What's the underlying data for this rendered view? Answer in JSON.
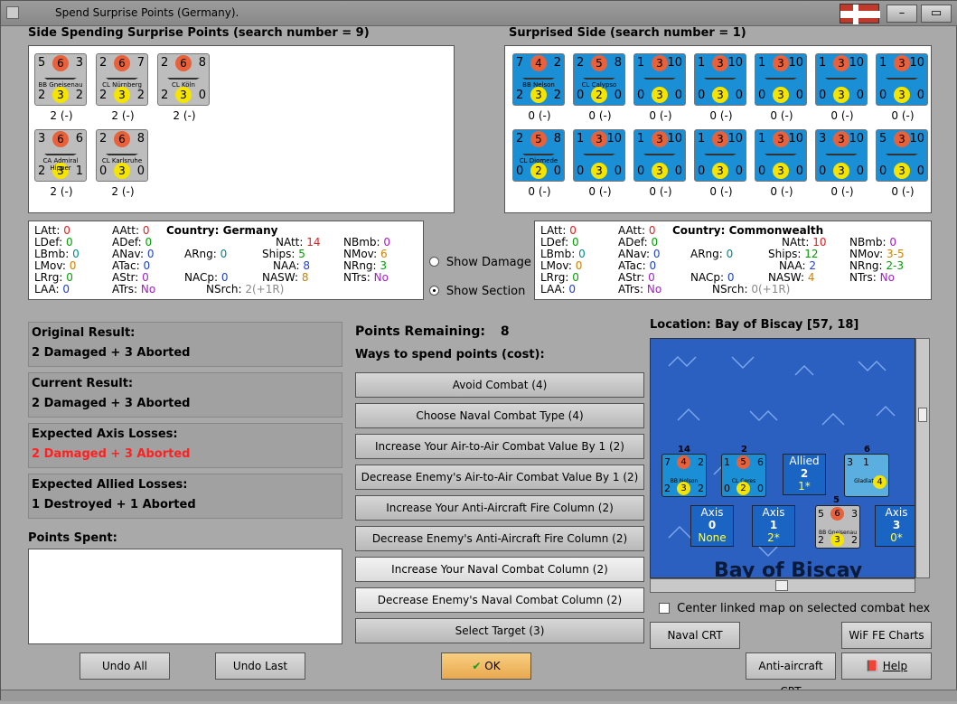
{
  "window": {
    "title": "Spend Surprise Points (Germany)."
  },
  "left_panel": {
    "header": "Side Spending Surprise Points (search number = 9)",
    "units": [
      {
        "name": "BB Gneisenau",
        "tl": "5",
        "tm": "6",
        "tr": "3",
        "bl": "2",
        "bm": "3",
        "br": "2",
        "label": "2 (-)"
      },
      {
        "name": "CL Nürnberg",
        "tl": "2",
        "tm": "6",
        "tr": "7",
        "bl": "2",
        "bm": "3",
        "br": "2",
        "label": "2 (-)"
      },
      {
        "name": "CL Köln",
        "tl": "2",
        "tm": "6",
        "tr": "8",
        "bl": "2",
        "bm": "3",
        "br": "0",
        "label": "2 (-)"
      },
      {
        "name": "CA Admiral Hipper",
        "tl": "3",
        "tm": "6",
        "tr": "6",
        "bl": "2",
        "bm": "3",
        "br": "1",
        "label": "2 (-)"
      },
      {
        "name": "CL Karlsruhe",
        "tl": "2",
        "tm": "6",
        "tr": "8",
        "bl": "0",
        "bm": "3",
        "br": "0",
        "label": "2 (-)"
      }
    ]
  },
  "right_panel": {
    "header": "Surprised Side (search number = 1)",
    "units": [
      {
        "name": "BB Nelson",
        "tl": "7",
        "tm": "4",
        "tr": "2",
        "bl": "2",
        "bm": "3",
        "br": "2",
        "label": "0 (-)"
      },
      {
        "name": "CL Calypso",
        "tl": "2",
        "tm": "5",
        "tr": "8",
        "bl": "0",
        "bm": "2",
        "br": "0",
        "label": "0 (-)"
      },
      {
        "name": "",
        "tl": "1",
        "tm": "3",
        "tr": "10",
        "bl": "0",
        "bm": "3",
        "br": "0",
        "label": "0 (-)"
      },
      {
        "name": "",
        "tl": "1",
        "tm": "3",
        "tr": "10",
        "bl": "0",
        "bm": "3",
        "br": "0",
        "label": "0 (-)"
      },
      {
        "name": "",
        "tl": "1",
        "tm": "3",
        "tr": "10",
        "bl": "0",
        "bm": "3",
        "br": "0",
        "label": "0 (-)"
      },
      {
        "name": "",
        "tl": "1",
        "tm": "3",
        "tr": "10",
        "bl": "0",
        "bm": "3",
        "br": "0",
        "label": "0 (-)"
      },
      {
        "name": "",
        "tl": "1",
        "tm": "3",
        "tr": "10",
        "bl": "0",
        "bm": "3",
        "br": "0",
        "label": "0 (-)"
      },
      {
        "name": "CL Diomede",
        "tl": "2",
        "tm": "5",
        "tr": "8",
        "bl": "0",
        "bm": "2",
        "br": "0",
        "label": "0 (-)"
      },
      {
        "name": "",
        "tl": "1",
        "tm": "3",
        "tr": "10",
        "bl": "0",
        "bm": "3",
        "br": "0",
        "label": "0 (-)"
      },
      {
        "name": "",
        "tl": "1",
        "tm": "3",
        "tr": "10",
        "bl": "0",
        "bm": "3",
        "br": "0",
        "label": "0 (-)"
      },
      {
        "name": "",
        "tl": "1",
        "tm": "3",
        "tr": "10",
        "bl": "0",
        "bm": "3",
        "br": "0",
        "label": "0 (-)"
      },
      {
        "name": "",
        "tl": "1",
        "tm": "3",
        "tr": "10",
        "bl": "0",
        "bm": "3",
        "br": "0",
        "label": "0 (-)"
      },
      {
        "name": "",
        "tl": "3",
        "tm": "3",
        "tr": "10",
        "bl": "0",
        "bm": "3",
        "br": "0",
        "label": "0 (-)"
      },
      {
        "name": "",
        "tl": "5",
        "tm": "3",
        "tr": "10",
        "bl": "0",
        "bm": "3",
        "br": "0",
        "label": "0 (-)"
      }
    ]
  },
  "stats_left": {
    "country_label": "Country: Germany",
    "LAtt": "0",
    "LDef": "0",
    "LBmb": "0",
    "LMov": "0",
    "LRrg": "0",
    "LAA": "0",
    "AAtt": "0",
    "ADef": "0",
    "ANav": "0",
    "ATac": "0",
    "AStr": "0",
    "ATrs": "No",
    "ARng": "0",
    "NACp": "0",
    "NSrch": "2(+1R)",
    "NAtt": "14",
    "Ships": "5",
    "NAA": "8",
    "NASW": "8",
    "NBmb": "0",
    "NMov": "6",
    "NRng": "3",
    "NTrs": "No"
  },
  "stats_right": {
    "country_label": "Country: Commonwealth",
    "LAtt": "0",
    "LDef": "0",
    "LBmb": "0",
    "LMov": "0",
    "LRrg": "0",
    "LAA": "0",
    "AAtt": "0",
    "ADef": "0",
    "ANav": "0",
    "ATac": "0",
    "AStr": "0",
    "ATrs": "No",
    "ARng": "0",
    "NACp": "0",
    "NSrch": "0(+1R)",
    "NAtt": "10",
    "Ships": "12",
    "NAA": "2",
    "NASW": "4",
    "NBmb": "0",
    "NMov": "3-5",
    "NRng": "2-3",
    "NTrs": "No"
  },
  "stat_labels": {
    "LAtt": "LAtt:",
    "LDef": "LDef:",
    "LBmb": "LBmb:",
    "LMov": "LMov:",
    "LRrg": "LRrg:",
    "LAA": "LAA:",
    "AAtt": "AAtt:",
    "ADef": "ADef:",
    "ANav": "ANav:",
    "ATac": "ATac:",
    "AStr": "AStr:",
    "ATrs": "ATrs:",
    "ARng": "ARng:",
    "NACp": "NACp:",
    "NSrch": "NSrch:",
    "NAtt": "NAtt:",
    "Ships": "Ships:",
    "NAA": "NAA:",
    "NASW": "NASW:",
    "NBmb": "NBmb:",
    "NMov": "NMov:",
    "NRng": "NRng:",
    "NTrs": "NTrs:"
  },
  "options": {
    "show_damage": "Show Damage",
    "show_section": "Show Section",
    "selected": "show_section"
  },
  "results": {
    "original_title": "Original Result:",
    "original_value": "2 Damaged + 3 Aborted",
    "current_title": "Current Result:",
    "current_value": "2 Damaged + 3 Aborted",
    "axis_title": "Expected Axis Losses:",
    "axis_value": "2 Damaged + 3 Aborted",
    "allied_title": "Expected Allied Losses:",
    "allied_value": "1 Destroyed + 1 Aborted",
    "spent_title": "Points Spent:"
  },
  "points": {
    "remaining_label": "Points Remaining:",
    "remaining_value": "8",
    "ways_label": "Ways to spend points (cost):"
  },
  "spend_buttons": [
    "Avoid Combat (4)",
    "Choose Naval Combat Type (4)",
    "Increase Your Air-to-Air Combat Value By 1 (2)",
    "Decrease Enemy's Air-to-Air Combat Value By 1 (2)",
    "Increase Your Anti-Aircraft Fire Column (2)",
    "Decrease Enemy's Anti-Aircraft Fire Column (2)",
    "Increase Your Naval Combat Column (2)",
    "Decrease Enemy's Naval Combat Column (2)",
    "Select Target (3)"
  ],
  "map": {
    "location": "Location: Bay of Biscay [57, 18]",
    "area_name": "Bay of Biscay",
    "stack_nelson": "14",
    "stack_ceres": "2",
    "stack_gladiator": "6",
    "stack_gneisenau": "5",
    "allied_box": {
      "title": "Allied",
      "value": "2",
      "sub": "1*"
    },
    "axis_boxes": [
      {
        "title": "Axis",
        "value": "0",
        "sub": "None"
      },
      {
        "title": "Axis",
        "value": "1",
        "sub": "2*"
      },
      {
        "title": "Axis",
        "value": "3",
        "sub": "0*"
      }
    ],
    "nelson": {
      "name": "BB Nelson",
      "tl": "7",
      "tm": "4",
      "tr": "2",
      "bl": "2",
      "bm": "3",
      "br": "2"
    },
    "ceres": {
      "name": "CL Ceres",
      "tl": "1",
      "tm": "5",
      "tr": "6",
      "bl": "0",
      "bm": "2",
      "br": "0"
    },
    "gladiator": {
      "name": "Gladiator",
      "tl": "3",
      "tm": "1",
      "bm": "4"
    },
    "gneisenau": {
      "name": "BB Gneisenau",
      "tl": "5",
      "tm": "6",
      "tr": "3",
      "bl": "2",
      "bm": "3",
      "br": "2"
    }
  },
  "center_linked": "Center linked map on selected combat hex",
  "bottom_buttons": {
    "undo_all": "Undo All",
    "undo_last": "Undo Last",
    "ok": "OK",
    "naval_crt": "Naval CRT",
    "wif_charts": "WiF FE Charts",
    "aa_crt": "Anti-aircraft CRT",
    "help": "Help"
  },
  "colors": {
    "counter_blue": "#1b8fd6",
    "counter_grey": "#bdbdbd",
    "attack_orange": "#e8613a",
    "yellow": "#f5e400",
    "map_blue": "#2b5fc0",
    "ok_orange": "#f0b860"
  }
}
